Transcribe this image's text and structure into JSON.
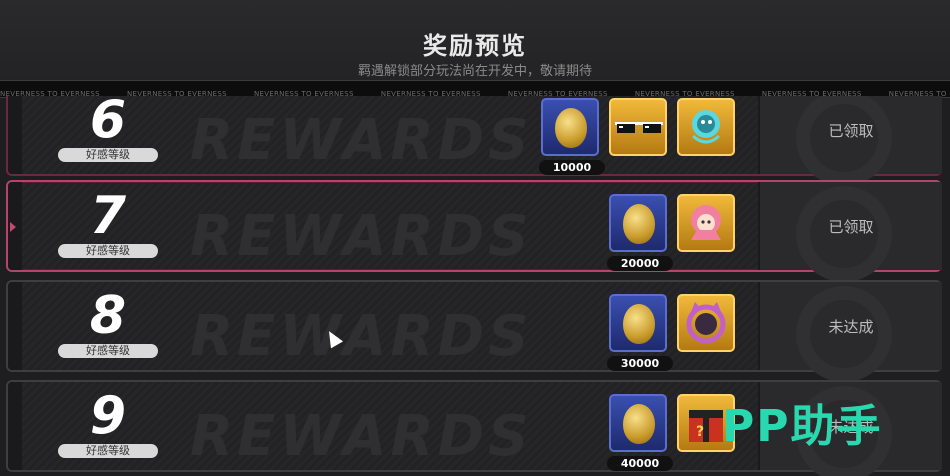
{
  "header": {
    "title": "奖励预览",
    "subtitle": "羁遇解锁部分玩法尚在开发中，敬请期待"
  },
  "ticker": {
    "text": "NEVERNESS TO EVERNESS"
  },
  "rows": [
    {
      "level": "6",
      "badge": "好感等级",
      "watermark": "REWARDS",
      "status": "已领取",
      "items": [
        {
          "icon": "gold-egg-icon",
          "frame": "blue",
          "qty": "10000"
        },
        {
          "icon": "sunglasses-icon",
          "frame": "gold",
          "qty": ""
        },
        {
          "icon": "blue-spirit-icon",
          "frame": "gold",
          "qty": ""
        }
      ]
    },
    {
      "level": "7",
      "badge": "好感等级",
      "watermark": "REWARDS",
      "status": "已领取",
      "items": [
        {
          "icon": "gold-egg-icon",
          "frame": "blue",
          "qty": "20000"
        },
        {
          "icon": "pink-character-icon",
          "frame": "gold",
          "qty": ""
        }
      ]
    },
    {
      "level": "8",
      "badge": "好感等级",
      "watermark": "REWARDS",
      "status": "未达成",
      "items": [
        {
          "icon": "gold-egg-icon",
          "frame": "blue",
          "qty": "30000"
        },
        {
          "icon": "cat-ring-frame-icon",
          "frame": "gold",
          "qty": ""
        }
      ]
    },
    {
      "level": "9",
      "badge": "好感等级",
      "watermark": "REWARDS",
      "status": "未达成",
      "items": [
        {
          "icon": "gold-egg-icon",
          "frame": "blue",
          "qty": "40000"
        },
        {
          "icon": "mystery-box-icon",
          "frame": "gold",
          "qty": ""
        }
      ]
    }
  ],
  "overlay_logo": "PP助手",
  "colors": {
    "accent_pink": "#b44468",
    "item_blue": "#3a4fb0",
    "item_gold": "#f0b93a",
    "logo_teal": "#2ad8b0"
  }
}
